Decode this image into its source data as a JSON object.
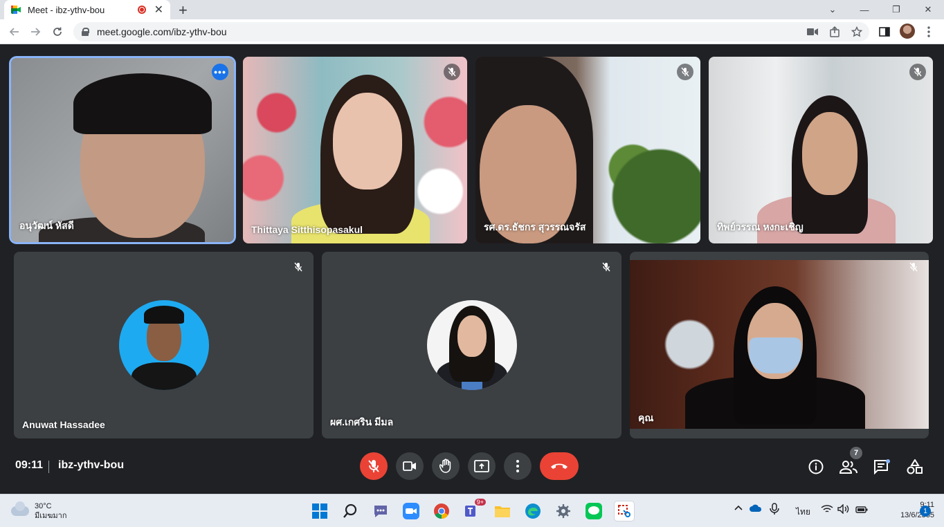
{
  "browser": {
    "tab_title": "Meet - ibz-ythv-bou",
    "new_tab_symbol": "+",
    "close_symbol": "✕",
    "url": "meet.google.com/ibz-ythv-bou",
    "window_controls": [
      "⌄",
      "—",
      "❐",
      "✕"
    ]
  },
  "meeting": {
    "time": "09:11",
    "code": "ibz-ythv-bou",
    "participant_count": "7"
  },
  "participants": [
    {
      "name": "อนุวัฒน์ หัสดี",
      "kind": "video",
      "muted": false,
      "pinned_menu": "•••"
    },
    {
      "name": "Thittaya Sitthisopasakul",
      "kind": "video",
      "muted": true
    },
    {
      "name": "รศ.ดร.ธัชกร สุวรรณจรัส",
      "kind": "video",
      "muted": true
    },
    {
      "name": "ทิพย์วรรณ หงกะเชิญ",
      "kind": "video",
      "muted": true
    },
    {
      "name": "Anuwat Hassadee",
      "kind": "avatar",
      "muted": true
    },
    {
      "name": "ผศ.เกศริน มีมล",
      "kind": "avatar",
      "muted": true
    },
    {
      "name": "คุณ",
      "kind": "video",
      "muted": true
    }
  ],
  "taskbar": {
    "weather_temp": "30°C",
    "weather_desc": "มีเมฆมาก",
    "language": "ไทย",
    "clock_time": "9:11",
    "clock_date": "13/6/2565",
    "notification_count": "1",
    "teams_badge": "9+"
  },
  "colors": {
    "accent": "#8ab4f8",
    "danger": "#ea4335",
    "meet_bg": "#202124",
    "tile_bg": "#3c4043"
  }
}
